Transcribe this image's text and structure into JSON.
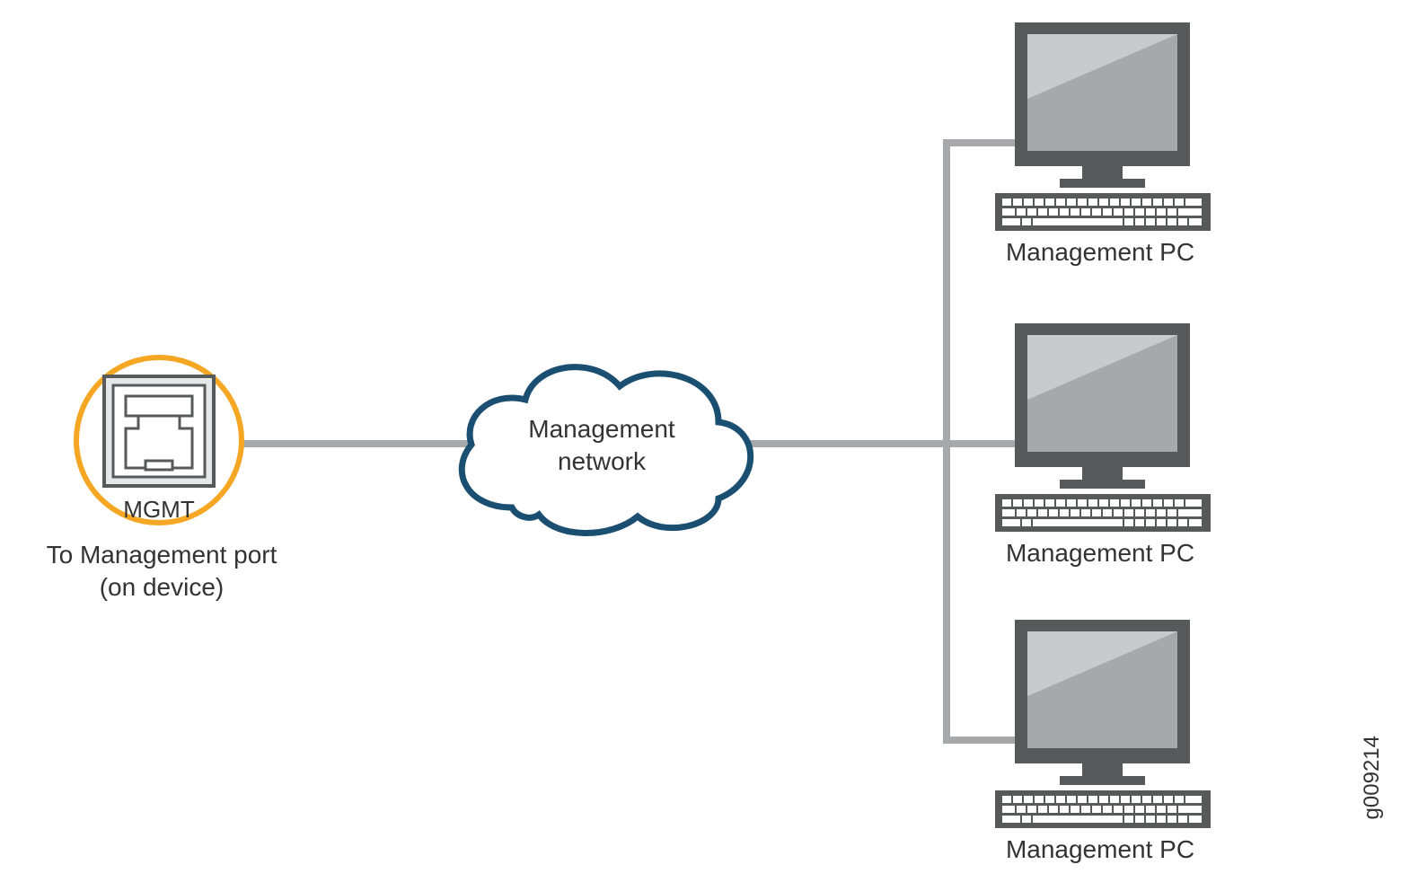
{
  "port": {
    "label": "MGMT",
    "caption_l1": "To Management port",
    "caption_l2": "(on device)"
  },
  "cloud": {
    "line1": "Management",
    "line2": "network"
  },
  "pcs": [
    {
      "label": "Management PC"
    },
    {
      "label": "Management PC"
    },
    {
      "label": "Management PC"
    }
  ],
  "figure_id": "g009214"
}
